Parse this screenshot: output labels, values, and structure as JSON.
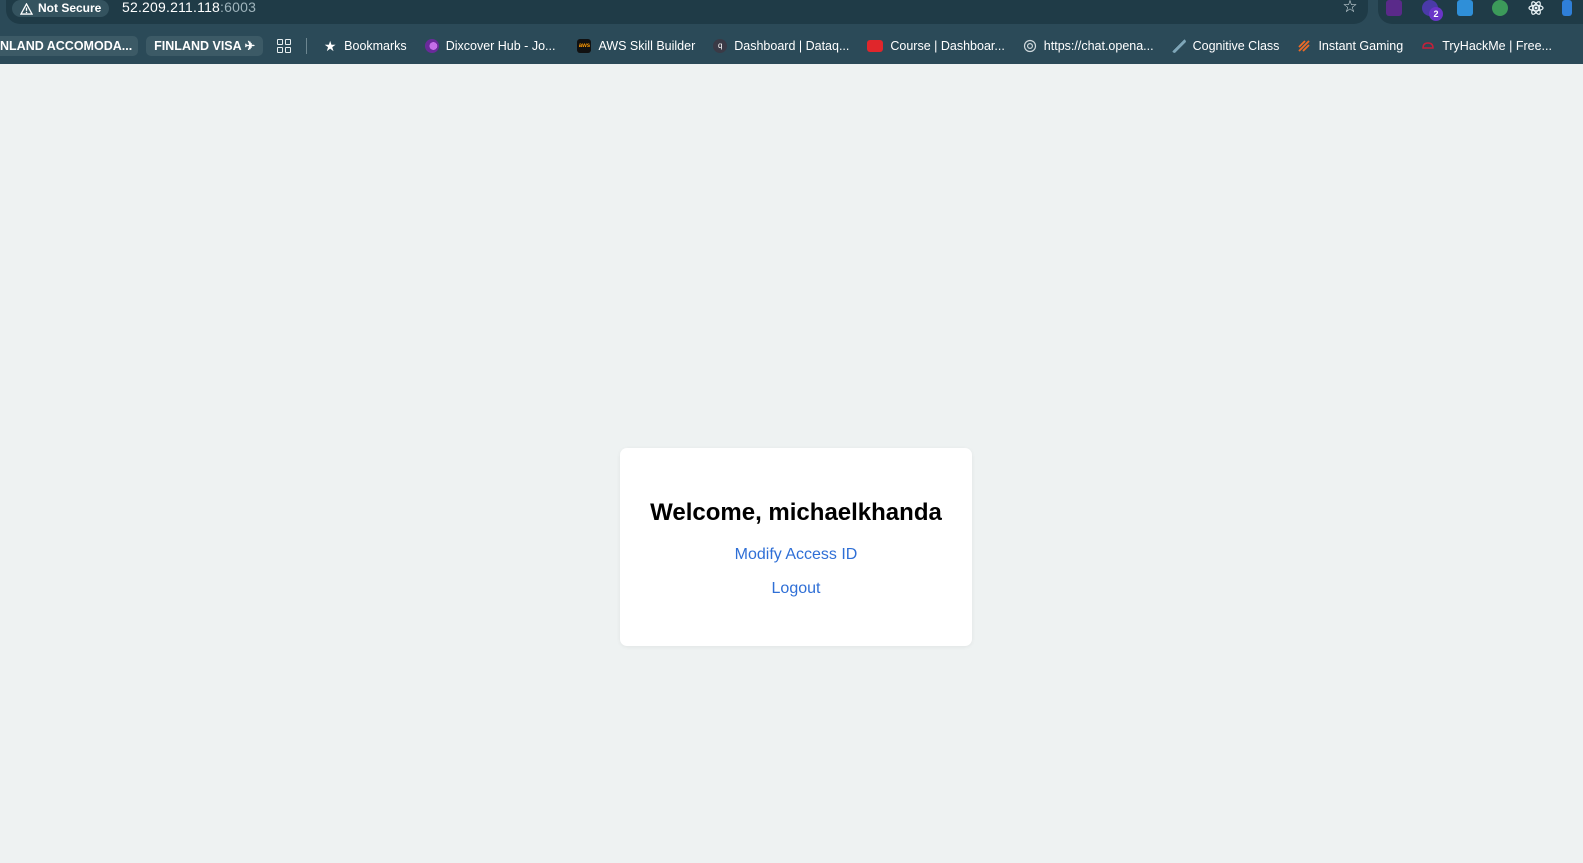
{
  "browser": {
    "security_label": "Not Secure",
    "url_host": "52.209.211.118",
    "url_port": ":6003",
    "extensions_badge": "2"
  },
  "bookmarks": {
    "pill_1": "NLAND ACCOMODA...",
    "pill_2": "FINLAND VISA ✈",
    "items": [
      {
        "label": "Bookmarks",
        "icon": "star-icon",
        "color": "#ffffff"
      },
      {
        "label": "Dixcover Hub - Jo...",
        "icon": "dixcover-icon",
        "color": "#8a3fd1"
      },
      {
        "label": "AWS Skill Builder",
        "icon": "aws-icon",
        "color": "#111111"
      },
      {
        "label": "Dashboard | Dataq...",
        "icon": "dataquest-icon",
        "color": "#3a3a46"
      },
      {
        "label": "Course | Dashboar...",
        "icon": "course-icon",
        "color": "#e0262b"
      },
      {
        "label": "https://chat.opena...",
        "icon": "openai-icon",
        "color": "#cfd8dc"
      },
      {
        "label": "Cognitive Class",
        "icon": "cognitive-class-icon",
        "color": "#2b4a58"
      },
      {
        "label": "Instant Gaming",
        "icon": "instant-gaming-icon",
        "color": "#f06a24"
      },
      {
        "label": "TryHackMe | Free...",
        "icon": "tryhackme-icon",
        "color": "#c4203a"
      }
    ]
  },
  "card": {
    "welcome": "Welcome, michaelkhanda",
    "modify_link": "Modify Access ID",
    "logout_link": "Logout"
  },
  "colors": {
    "page_bg": "#eef2f2",
    "chrome_bg": "#2b4a58",
    "link": "#2f6fd6"
  }
}
